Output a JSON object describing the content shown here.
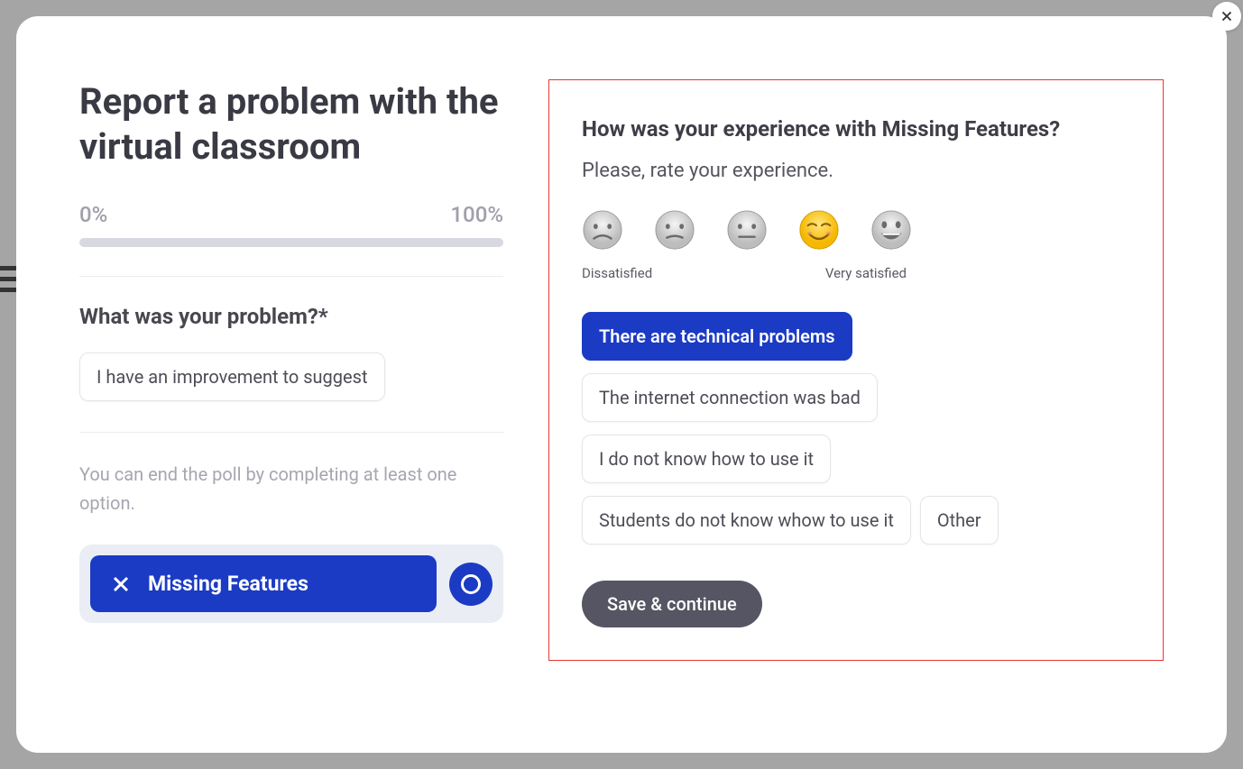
{
  "left": {
    "title": "Report a problem with the virtual classroom",
    "progress_low": "0%",
    "progress_high": "100%",
    "question": "What was your problem?*",
    "suggestion_chip": "I have an improvement to suggest",
    "hint": "You can end the poll by completing at least one option.",
    "option_label": "Missing Features"
  },
  "right": {
    "title": "How was your experience with Missing Features?",
    "subtitle": "Please, rate your experience.",
    "scale_low": "Dissatisfied",
    "scale_high": "Very satisfied",
    "reasons": {
      "r1": "There are technical problems",
      "r2": "The internet connection was bad",
      "r3": "I do not know how to use it",
      "r4": "Students do not know whow to use it",
      "r5": "Other"
    },
    "save": "Save & continue"
  }
}
